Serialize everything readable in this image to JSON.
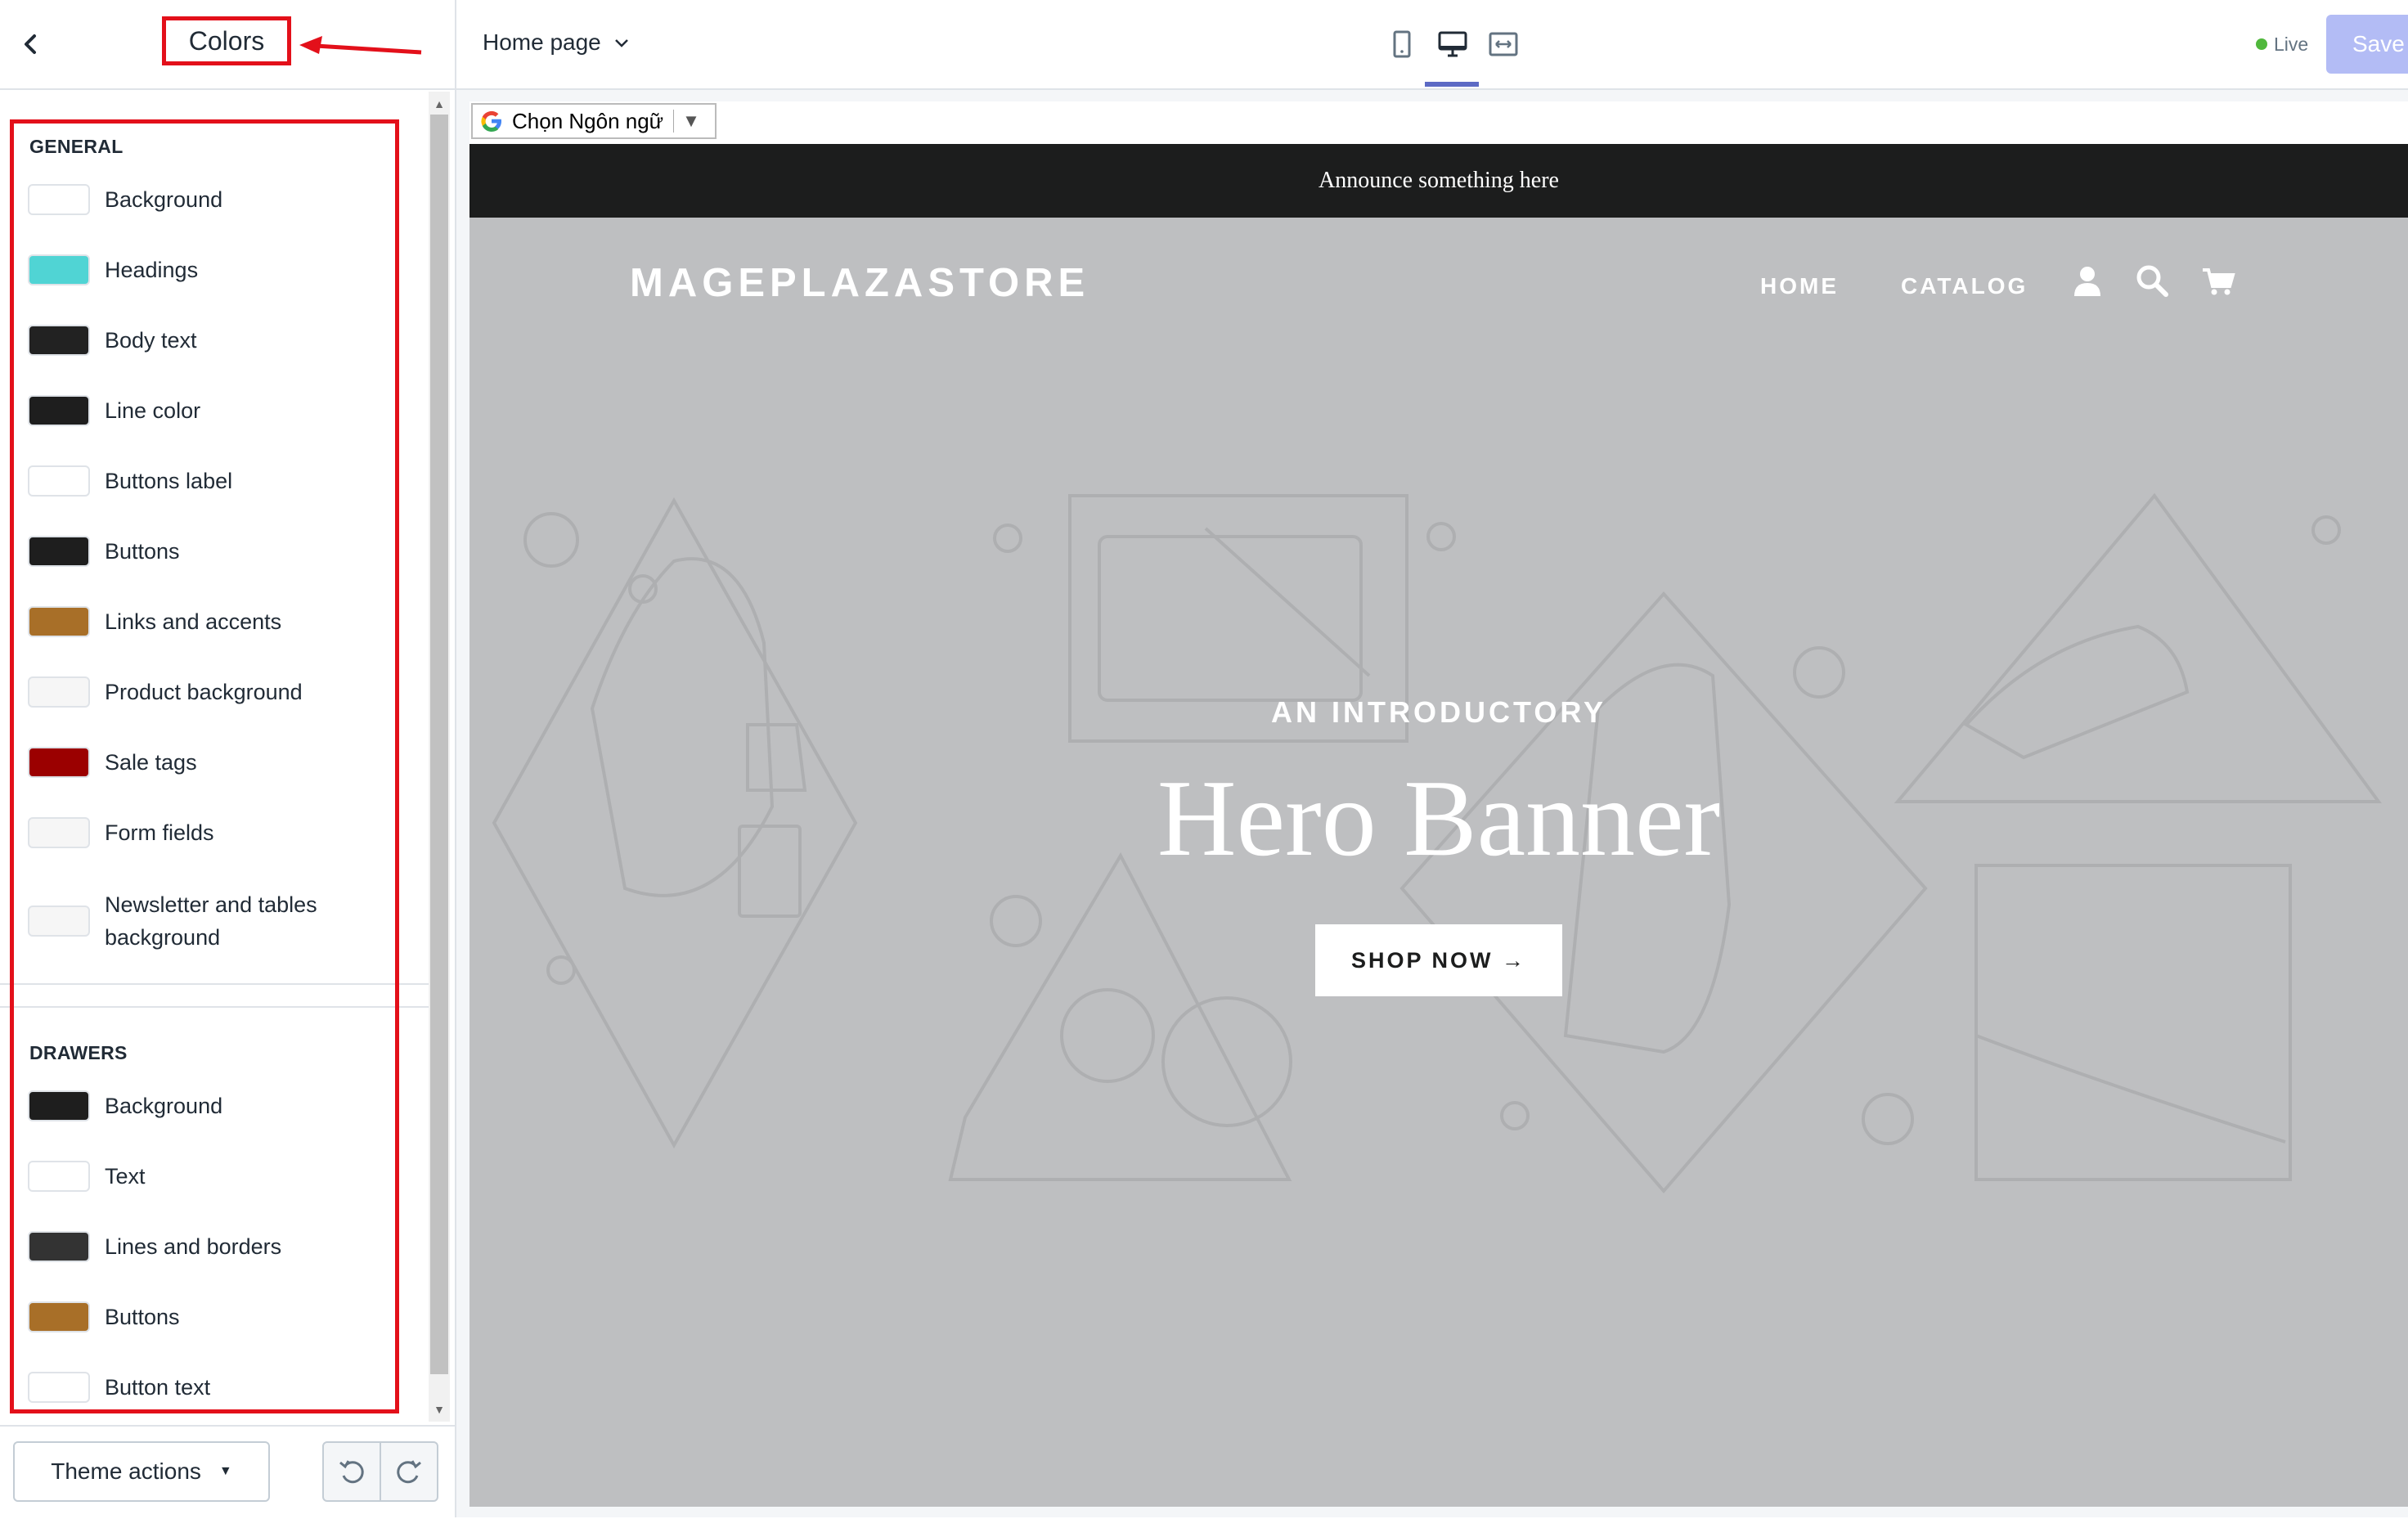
{
  "sidebar": {
    "title": "Colors",
    "general_section": {
      "title": "GENERAL",
      "items": [
        {
          "label": "Background",
          "color": "#ffffff"
        },
        {
          "label": "Headings",
          "color": "#50d4d4"
        },
        {
          "label": "Body text",
          "color": "#222222"
        },
        {
          "label": "Line color",
          "color": "#1e1e1e"
        },
        {
          "label": "Buttons label",
          "color": "#ffffff"
        },
        {
          "label": "Buttons",
          "color": "#1e1e1e"
        },
        {
          "label": "Links and accents",
          "color": "#a86f28"
        },
        {
          "label": "Product background",
          "color": "#f6f6f6"
        },
        {
          "label": "Sale tags",
          "color": "#9b0000"
        },
        {
          "label": "Form fields",
          "color": "#f6f6f6"
        },
        {
          "label": "Newsletter and tables background",
          "color": "#f6f6f6"
        }
      ]
    },
    "drawers_section": {
      "title": "DRAWERS",
      "items": [
        {
          "label": "Background",
          "color": "#1e1e1e"
        },
        {
          "label": "Text",
          "color": "#ffffff"
        },
        {
          "label": "Lines and borders",
          "color": "#333333"
        },
        {
          "label": "Buttons",
          "color": "#a86f28"
        },
        {
          "label": "Button text",
          "color": "#ffffff"
        }
      ]
    },
    "footer": {
      "theme_actions_label": "Theme actions"
    }
  },
  "topbar": {
    "page_selector": "Home page",
    "active_device": "desktop",
    "status": "Live",
    "save_label": "Save"
  },
  "preview": {
    "translate_widget": "Chọn Ngôn ngữ",
    "announcement": "Announce something here",
    "store_name": "MAGEPLAZASTORE",
    "nav": [
      "HOME",
      "CATALOG"
    ],
    "hero_kicker": "AN INTRODUCTORY",
    "hero_title": "Hero Banner",
    "cta_label": "SHOP NOW →"
  },
  "colors": {
    "annotation_red": "#e3101a",
    "accent": "#5c6ac4",
    "save_disabled": "#b3bcf5",
    "live_dot": "#50b83c",
    "announcement_bg": "#1c1d1d",
    "hero_bg": "#bebfc1"
  }
}
